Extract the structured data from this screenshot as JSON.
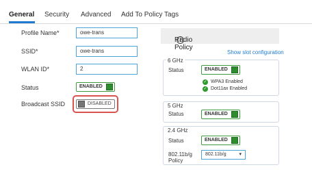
{
  "tabs": [
    {
      "label": "General",
      "active": true
    },
    {
      "label": "Security",
      "active": false
    },
    {
      "label": "Advanced",
      "active": false
    },
    {
      "label": "Add To Policy Tags",
      "active": false
    }
  ],
  "general": {
    "profile_name": {
      "label": "Profile Name*",
      "value": "owe-trans"
    },
    "ssid": {
      "label": "SSID*",
      "value": "owe-trans"
    },
    "wlan_id": {
      "label": "WLAN ID*",
      "value": "2"
    },
    "status": {
      "label": "Status",
      "value": "ENABLED"
    },
    "broadcast_ssid": {
      "label": "Broadcast SSID",
      "value": "DISABLED"
    }
  },
  "radio_policy": {
    "title": "Radio Policy",
    "info_icon": "info-icon",
    "slot_link": "Show slot configuration",
    "ghz6": {
      "title": "6 GHz",
      "status_label": "Status",
      "status_value": "ENABLED",
      "checks": [
        "WPA3 Enabled",
        "Dot11ax Enabled"
      ]
    },
    "ghz5": {
      "title": "5 GHz",
      "status_label": "Status",
      "status_value": "ENABLED"
    },
    "ghz24": {
      "title": "2.4 GHz",
      "status_label": "Status",
      "status_value": "ENABLED",
      "policy_label_1": "802.11b/g",
      "policy_label_2": "Policy",
      "policy_value": "802.11b/g"
    }
  },
  "colors": {
    "accent": "#1f7ad1",
    "enabled_green": "#2e8b2e",
    "highlight_red": "#d9534f"
  }
}
